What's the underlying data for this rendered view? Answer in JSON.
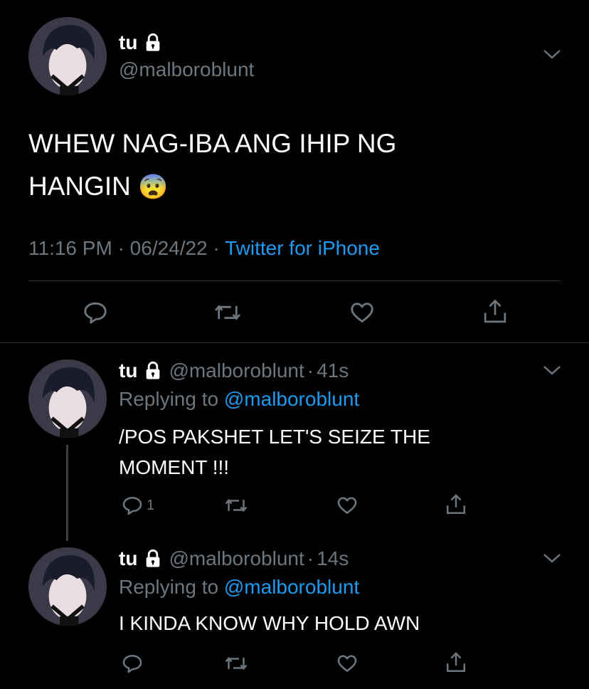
{
  "main_tweet": {
    "display_name": "tu",
    "handle": "@malboroblunt",
    "text_line1": "WHEW NAG-IBA ANG IHIP NG",
    "text_line2": "HANGIN",
    "emoji": "😨",
    "time": "11:16 PM",
    "date": "06/24/22",
    "separator": "·",
    "source": "Twitter for iPhone"
  },
  "replies": [
    {
      "display_name": "tu",
      "handle": "@malboroblunt",
      "dot": "·",
      "age": "41s",
      "replying_prefix": "Replying to",
      "replying_to": "@malboroblunt",
      "text_line1": "/POS PAKSHET LET'S SEIZE THE",
      "text_line2": "MOMENT !!!",
      "reply_count": "1"
    },
    {
      "display_name": "tu",
      "handle": "@malboroblunt",
      "dot": "·",
      "age": "14s",
      "replying_prefix": "Replying to",
      "replying_to": "@malboroblunt",
      "text_line1": "I KINDA KNOW WHY HOLD AWN",
      "reply_count": ""
    }
  ],
  "icons": {
    "lock": "lock-icon",
    "chevron": "chevron-down-icon",
    "reply": "reply-icon",
    "retweet": "retweet-icon",
    "like": "heart-icon",
    "share": "share-icon"
  },
  "colors": {
    "background": "#000000",
    "text": "#ffffff",
    "muted": "#6e767d",
    "link": "#1d9bf0",
    "divider": "#2f3336"
  }
}
